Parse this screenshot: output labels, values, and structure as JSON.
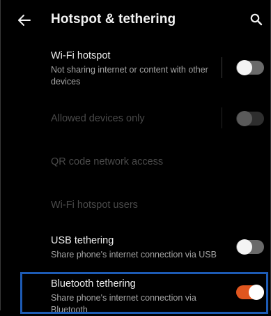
{
  "header": {
    "title": "Hotspot & tethering",
    "back_icon": "arrow-left-icon",
    "search_icon": "search-icon"
  },
  "items": [
    {
      "label": "Wi-Fi hotspot",
      "subtitle": "Not sharing internet or content with other devices",
      "toggle": "off",
      "enabled": true
    },
    {
      "label": "Allowed devices only",
      "toggle": "off",
      "enabled": false
    },
    {
      "label": "QR code network access",
      "enabled": false
    },
    {
      "label": "Wi-Fi hotspot users",
      "enabled": false
    },
    {
      "label": "USB tethering",
      "subtitle": "Share phone's internet connection via USB",
      "toggle": "off",
      "enabled": true
    },
    {
      "label": "Bluetooth tethering",
      "subtitle": "Share phone's internet connection via Bluetooth",
      "toggle": "on",
      "enabled": true,
      "highlighted": true
    }
  ],
  "colors": {
    "background": "#000000",
    "accent_toggle_on": "#e0561f",
    "highlight_border": "#1d5bb4",
    "text_primary": "#ececec",
    "text_secondary": "#a5a5a5",
    "text_disabled": "#4a4a4a"
  }
}
